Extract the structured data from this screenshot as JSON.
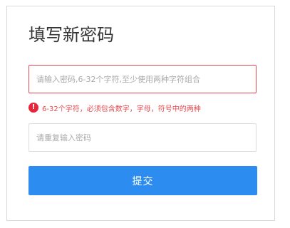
{
  "form": {
    "title": "填写新密码",
    "password": {
      "value": "",
      "placeholder": "请输入密码,6-32个字符,至少使用两种字符组合"
    },
    "error": {
      "icon": "!",
      "text": "6-32个字符，必须包含数字，字母，符号中的两种"
    },
    "confirm": {
      "value": "",
      "placeholder": "请重复输入密码"
    },
    "submit_label": "提交"
  },
  "colors": {
    "error": "#e64a4f",
    "primary": "#2d8cf0",
    "border": "#dcdcdc"
  }
}
